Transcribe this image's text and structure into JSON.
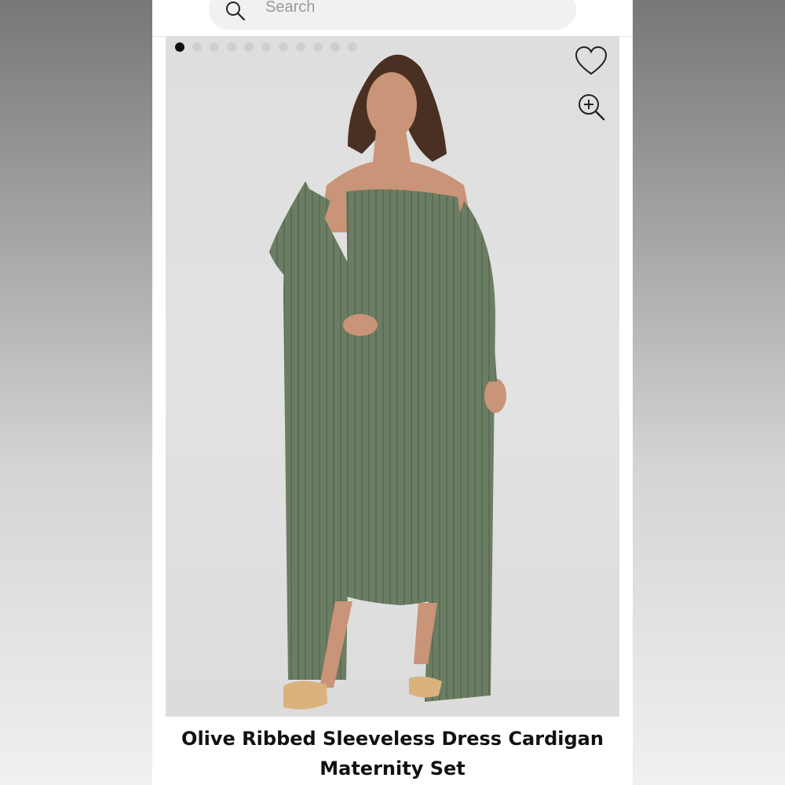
{
  "search": {
    "placeholder": "Search"
  },
  "gallery": {
    "dots_total": 11,
    "active_index": 0
  },
  "icons": {
    "wishlist": "heart-icon",
    "zoom": "zoom-in-icon",
    "search": "search-icon"
  },
  "product": {
    "title_line1": "Olive Ribbed Sleeveless Dress Cardigan",
    "title_line2": "Maternity Set"
  },
  "colors": {
    "garment": "#6b7d63",
    "background": "#e9e9e9"
  }
}
